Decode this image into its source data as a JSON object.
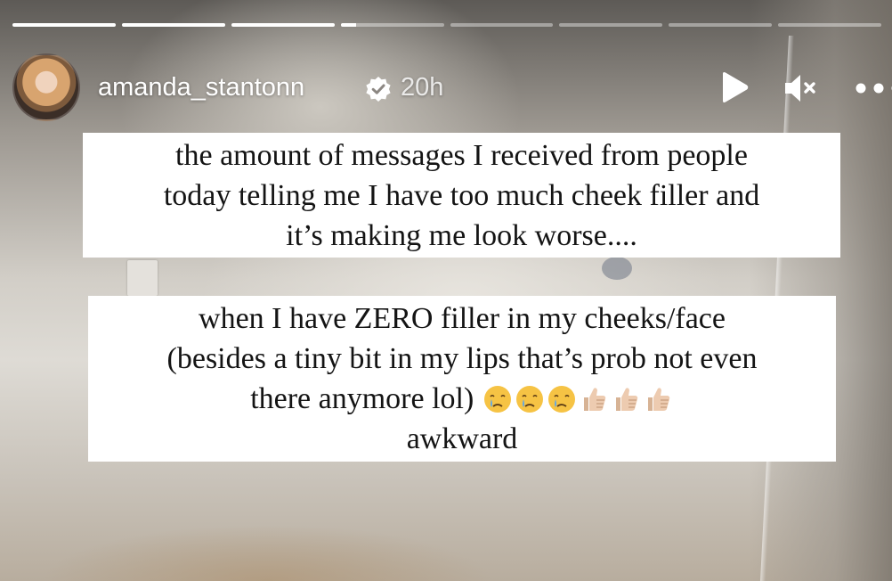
{
  "story": {
    "progress": [
      1,
      1,
      1,
      0.15,
      0,
      0,
      0,
      0
    ],
    "user": {
      "username": "amanda_stantonn",
      "verified": true,
      "posted": "20h",
      "avatar": "avatar"
    },
    "controls": {
      "play": "play-icon",
      "mute": "mute-icon",
      "more": "more-icon"
    },
    "captions": {
      "first": [
        "the amount of messages I received from people",
        "today telling me I have too much cheek filler and",
        "it’s making me look worse...."
      ],
      "second": {
        "line1": "when I have ZERO filler in my cheeks/face",
        "line2": "(besides a tiny bit in my lips that’s prob not even",
        "line3": "there anymore lol)",
        "emojis": [
          "face-holding-back-tears",
          "face-holding-back-tears",
          "face-holding-back-tears",
          "thumbs-up",
          "thumbs-up",
          "thumbs-up"
        ],
        "line4": "awkward"
      }
    }
  }
}
